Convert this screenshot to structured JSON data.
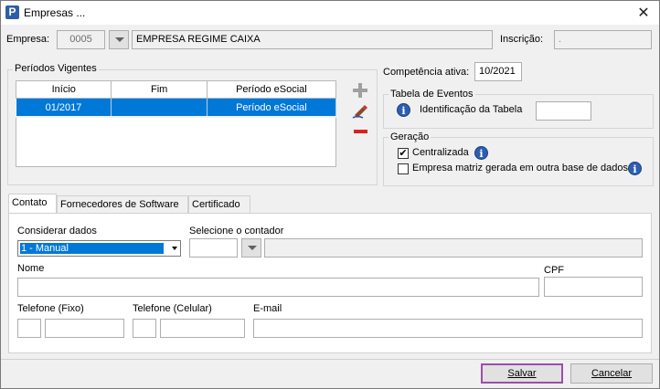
{
  "window": {
    "title": "Empresas ...",
    "icon": "app-logo-icon",
    "close_icon": "close-icon"
  },
  "empresa": {
    "label": "Empresa:",
    "code": "0005",
    "name": "EMPRESA REGIME CAIXA",
    "inscricao_label": "Inscrição:",
    "inscricao_value": "."
  },
  "periodos": {
    "title": "Períodos Vigentes",
    "columns": [
      "Início",
      "Fim",
      "Período eSocial"
    ],
    "rows": [
      {
        "inicio": "01/2017",
        "fim": "",
        "periodo": "Período eSocial"
      }
    ]
  },
  "competencia": {
    "label": "Competência ativa:",
    "value": "10/2021"
  },
  "tabela_eventos": {
    "title": "Tabela de Eventos",
    "label": "Identificação da Tabela",
    "value": ""
  },
  "geracao": {
    "title": "Geração",
    "centralizada_label": "Centralizada",
    "centralizada_checked": true,
    "matriz_label": "Empresa matriz gerada em outra base de dados",
    "matriz_checked": false
  },
  "tabs": [
    {
      "label": "Contato"
    },
    {
      "label": "Fornecedores de Software"
    },
    {
      "label": "Certificado"
    }
  ],
  "contato": {
    "considerar_label": "Considerar dados",
    "considerar_value": "1 - Manual",
    "contador_label": "Selecione o contador",
    "nome_label": "Nome",
    "cpf_label": "CPF",
    "tel_fixo_label": "Telefone (Fixo)",
    "tel_cel_label": "Telefone (Celular)",
    "email_label": "E-mail"
  },
  "buttons": {
    "salvar": "Salvar",
    "cancelar": "Cancelar"
  },
  "colors": {
    "selection": "#0078d7",
    "focus_border": "#9b4fa8",
    "remove_icon": "#e02020",
    "add_icon": "#a0a0a0"
  }
}
